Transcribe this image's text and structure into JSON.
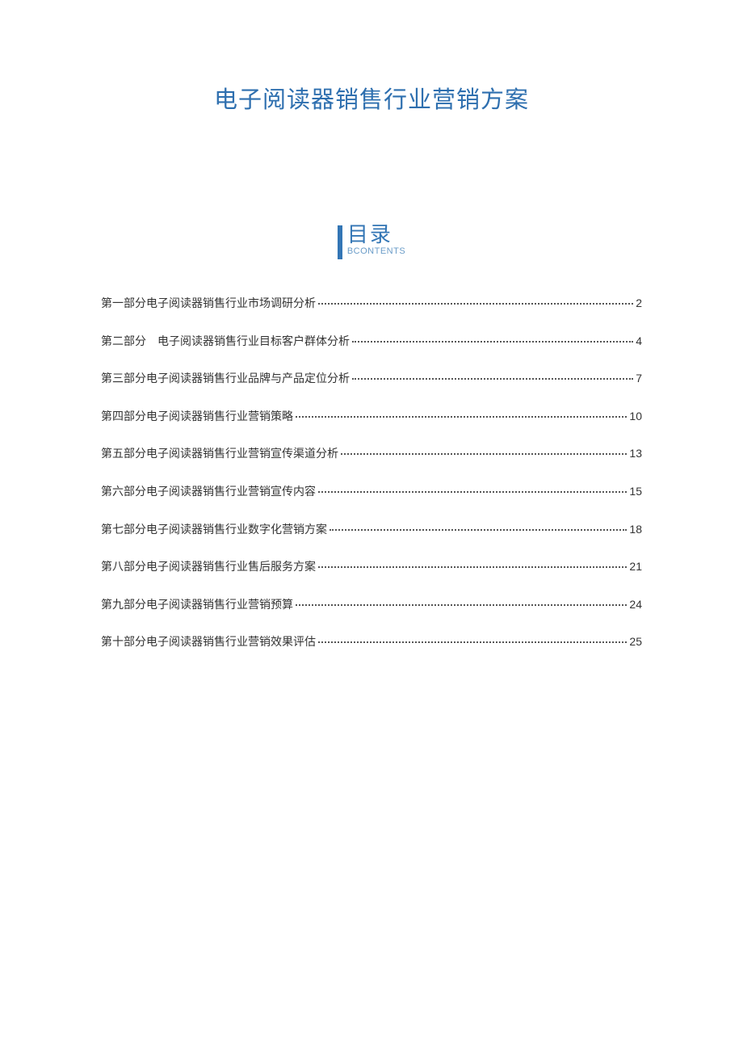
{
  "title": "电子阅读器销售行业营销方案",
  "toc": {
    "label": "目录",
    "sublabel": "BCONTENTS",
    "items": [
      {
        "text": "第一部分电子阅读器销售行业市场调研分析",
        "page": "2"
      },
      {
        "text": "第二部分　电子阅读器销售行业目标客户群体分析",
        "page": "4"
      },
      {
        "text": "第三部分电子阅读器销售行业品牌与产品定位分析",
        "page": "7"
      },
      {
        "text": "第四部分电子阅读器销售行业营销策略",
        "page": "10"
      },
      {
        "text": "第五部分电子阅读器销售行业营销宣传渠道分析",
        "page": "13"
      },
      {
        "text": "第六部分电子阅读器销售行业营销宣传内容",
        "page": "15"
      },
      {
        "text": "第七部分电子阅读器销售行业数字化营销方案",
        "page": "18"
      },
      {
        "text": "第八部分电子阅读器销售行业售后服务方案",
        "page": "21"
      },
      {
        "text": "第九部分电子阅读器销售行业营销预算",
        "page": "24"
      },
      {
        "text": "第十部分电子阅读器销售行业营销效果评估",
        "page": "25"
      }
    ]
  }
}
